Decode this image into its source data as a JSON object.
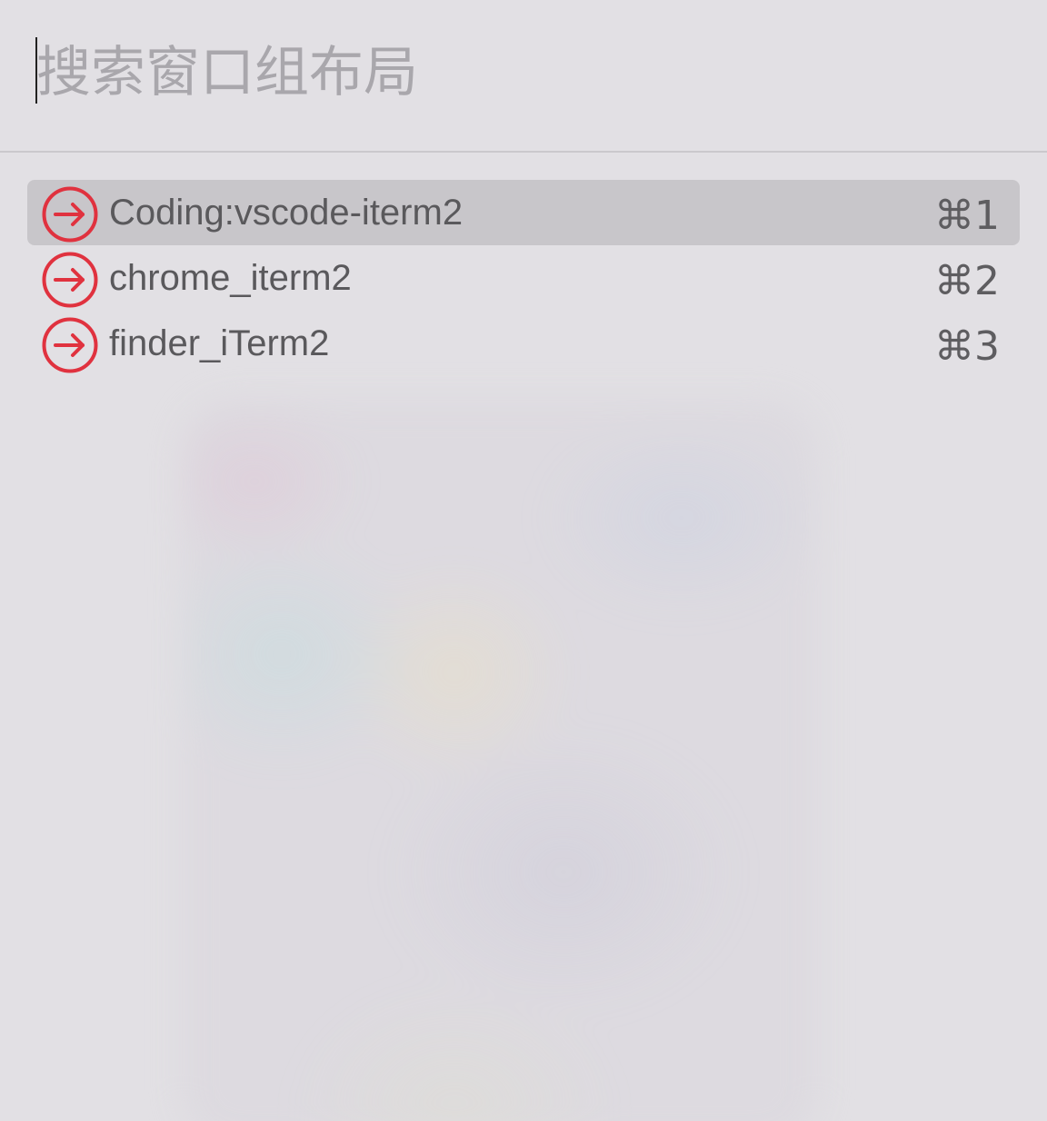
{
  "search": {
    "placeholder": "搜索窗口组布局",
    "value": ""
  },
  "results": [
    {
      "label": "Coding:vscode-iterm2",
      "shortcut": "⌘1",
      "selected": true,
      "icon": "arrow-right-circle-icon"
    },
    {
      "label": "chrome_iterm2",
      "shortcut": "⌘2",
      "selected": false,
      "icon": "arrow-right-circle-icon"
    },
    {
      "label": "finder_iTerm2",
      "shortcut": "⌘3",
      "selected": false,
      "icon": "arrow-right-circle-icon"
    }
  ],
  "colors": {
    "icon_accent": "#e0323f",
    "panel_background": "#e2e0e4",
    "selected_row": "#c8c6ca"
  }
}
